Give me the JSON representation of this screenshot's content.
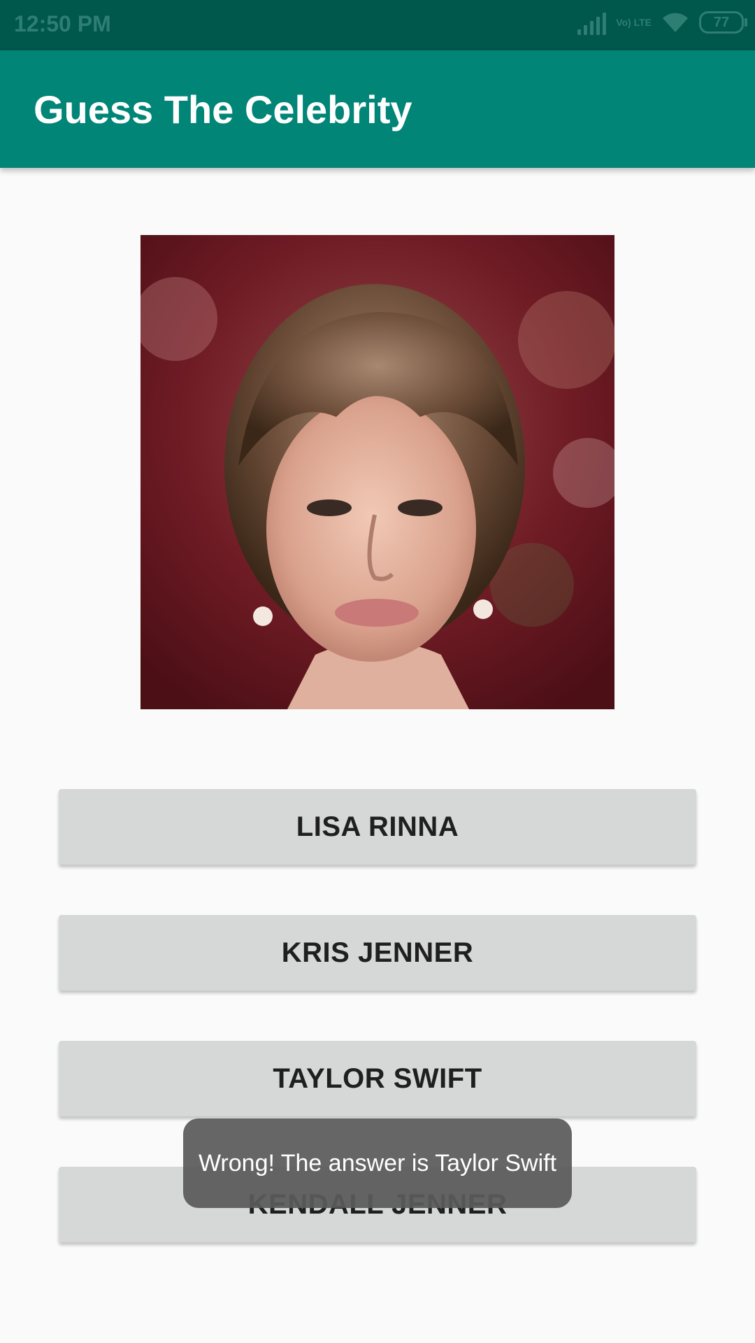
{
  "status_bar": {
    "time": "12:50 PM",
    "network": "Vo) LTE",
    "battery": "77",
    "icons": [
      "signal-icon",
      "lte-icon",
      "wifi-icon",
      "battery-icon"
    ]
  },
  "app_bar": {
    "title": "Guess The Celebrity",
    "color": "#008577"
  },
  "quiz": {
    "image_icon": "celebrity-portrait",
    "options": [
      "LISA RINNA",
      "KRIS JENNER",
      "TAYLOR SWIFT",
      "KENDALL JENNER"
    ]
  },
  "toast": {
    "message": "Wrong! The answer is Taylor Swift"
  },
  "colors": {
    "status_bar": "#00574b",
    "app_bar": "#008577",
    "button": "#d6d7d7",
    "background": "#fafafa"
  }
}
